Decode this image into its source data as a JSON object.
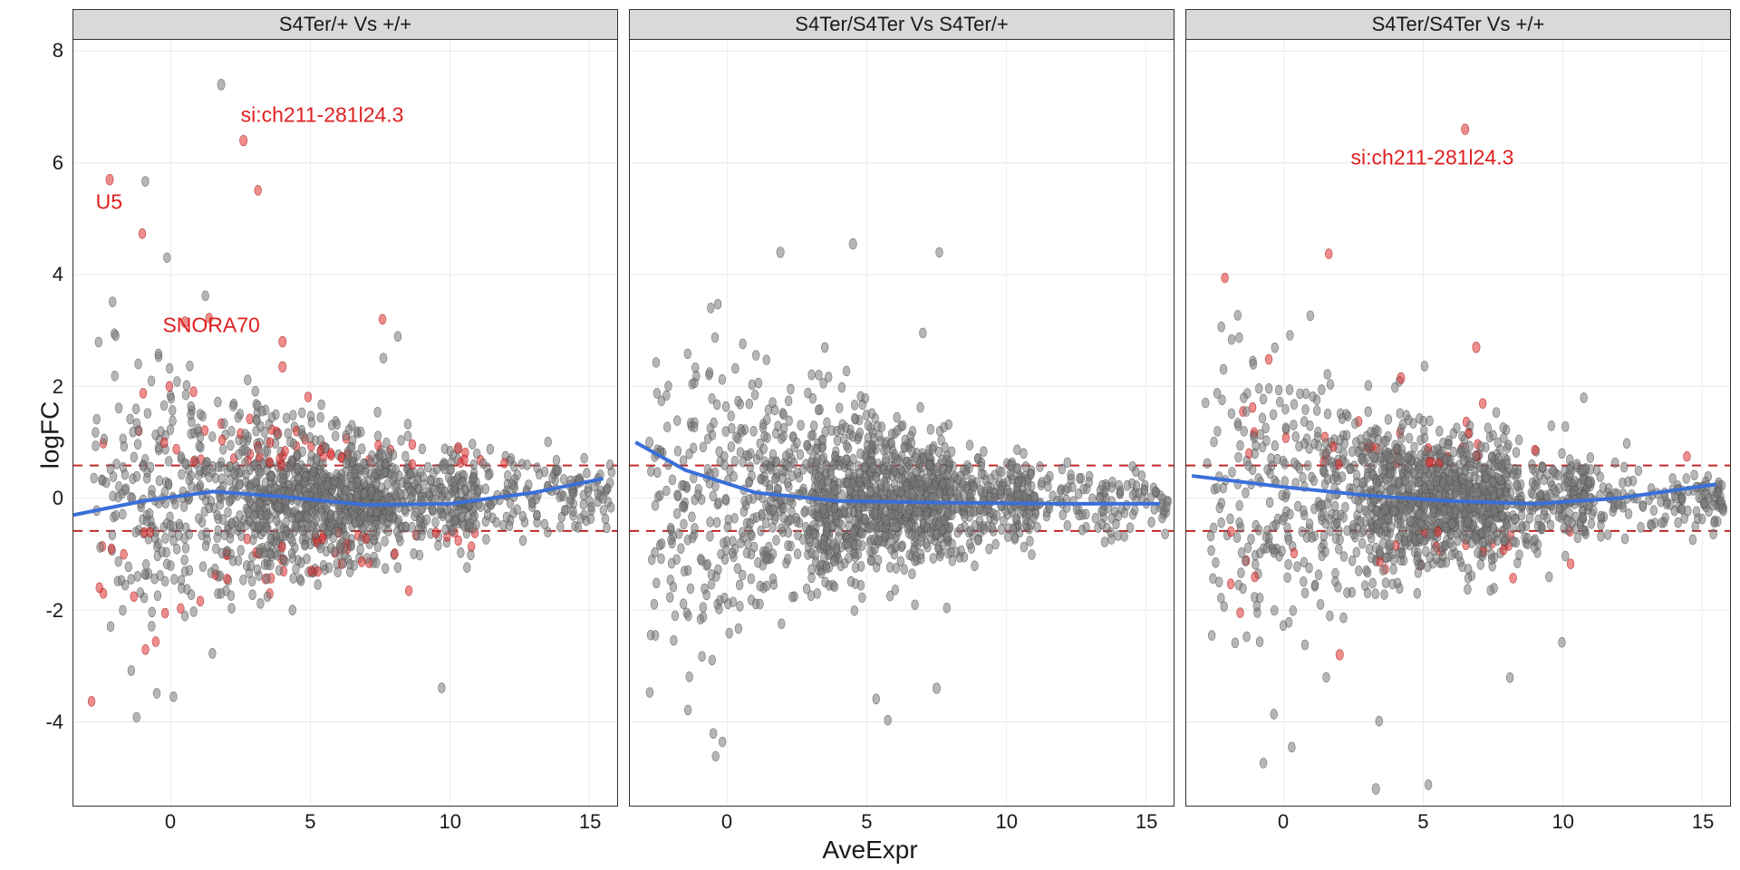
{
  "chart_data": {
    "type": "scatter",
    "xlabel": "AveExpr",
    "ylabel": "logFC",
    "xlim": [
      -3.5,
      16
    ],
    "ylim": [
      -5.5,
      8.2
    ],
    "x_ticks": [
      0,
      5,
      10,
      15
    ],
    "y_ticks": [
      -4,
      -2,
      0,
      2,
      4,
      6,
      8
    ],
    "hlines": [
      0.585,
      -0.585
    ],
    "panels": [
      {
        "title": "S4Ter/+ Vs +/+",
        "loess": [
          {
            "x": -3.5,
            "y": -0.3
          },
          {
            "x": -1.0,
            "y": -0.05
          },
          {
            "x": 1.5,
            "y": 0.12
          },
          {
            "x": 4.0,
            "y": 0.03
          },
          {
            "x": 7.0,
            "y": -0.12
          },
          {
            "x": 10.0,
            "y": -0.1
          },
          {
            "x": 13.0,
            "y": 0.1
          },
          {
            "x": 15.5,
            "y": 0.35
          }
        ],
        "annotations": [
          {
            "label": "si:ch211-281l24.3",
            "x": 2.5,
            "y": 6.85
          },
          {
            "label": "U5",
            "x": -2.7,
            "y": 5.3
          },
          {
            "label": "SNORA70",
            "x": -0.3,
            "y": 3.1
          }
        ],
        "special_points": [
          {
            "x": 1.8,
            "y": 7.4,
            "red": false
          },
          {
            "x": 2.6,
            "y": 6.4,
            "red": true
          },
          {
            "x": -2.2,
            "y": 5.7,
            "red": true
          },
          {
            "x": 0.5,
            "y": 3.15,
            "red": true
          },
          {
            "x": 4.0,
            "y": 2.35,
            "red": true
          },
          {
            "x": 4.0,
            "y": 2.8,
            "red": true
          },
          {
            "x": 10.3,
            "y": 0.9,
            "red": true
          }
        ],
        "red_fraction": 0.05
      },
      {
        "title": "S4Ter/S4Ter Vs S4Ter/+",
        "loess": [
          {
            "x": -3.3,
            "y": 1.0
          },
          {
            "x": -1.5,
            "y": 0.5
          },
          {
            "x": 1.0,
            "y": 0.1
          },
          {
            "x": 4.0,
            "y": -0.05
          },
          {
            "x": 8.0,
            "y": -0.08
          },
          {
            "x": 12.0,
            "y": -0.1
          },
          {
            "x": 15.5,
            "y": -0.1
          }
        ],
        "annotations": [],
        "special_points": [
          {
            "x": 4.5,
            "y": 4.55,
            "red": false
          },
          {
            "x": 1.9,
            "y": 4.4,
            "red": false
          },
          {
            "x": -2.8,
            "y": 1.0,
            "red": false
          },
          {
            "x": 7.5,
            "y": -3.4,
            "red": false
          }
        ],
        "red_fraction": 0.0
      },
      {
        "title": "S4Ter/S4Ter Vs +/+",
        "loess": [
          {
            "x": -3.3,
            "y": 0.4
          },
          {
            "x": 0.0,
            "y": 0.2
          },
          {
            "x": 3.0,
            "y": 0.05
          },
          {
            "x": 6.0,
            "y": -0.05
          },
          {
            "x": 9.0,
            "y": -0.1
          },
          {
            "x": 12.0,
            "y": 0.0
          },
          {
            "x": 15.5,
            "y": 0.25
          }
        ],
        "annotations": [
          {
            "label": "si:ch211-281l24.3",
            "x": 2.4,
            "y": 6.1
          }
        ],
        "special_points": [
          {
            "x": 6.5,
            "y": 6.6,
            "red": true
          },
          {
            "x": 6.9,
            "y": 2.7,
            "red": true
          },
          {
            "x": 4.2,
            "y": 2.15,
            "red": true
          },
          {
            "x": 2.0,
            "y": -2.8,
            "red": true
          },
          {
            "x": 3.3,
            "y": -5.2,
            "red": false
          }
        ],
        "red_fraction": 0.02
      }
    ],
    "cloud": {
      "n_points": 1600,
      "seed": 987654321
    }
  }
}
